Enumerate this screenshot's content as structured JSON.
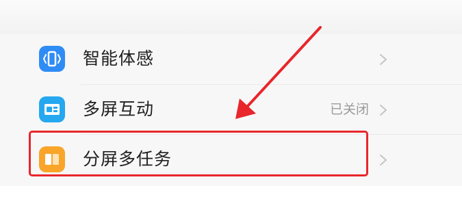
{
  "settings_list": {
    "items": [
      {
        "label": "智能体感",
        "value": "",
        "icon": "phone-motion-icon",
        "icon_color": "#2f8cf5"
      },
      {
        "label": "多屏互动",
        "value": "已关闭",
        "icon": "screen-cast-icon",
        "icon_color": "#25a8ef"
      },
      {
        "label": "分屏多任务",
        "value": "",
        "icon": "split-screen-icon",
        "icon_color": "#f9a52a"
      }
    ]
  },
  "annotation": {
    "color": "#e8262b",
    "highlighted_item": "分屏多任务"
  }
}
